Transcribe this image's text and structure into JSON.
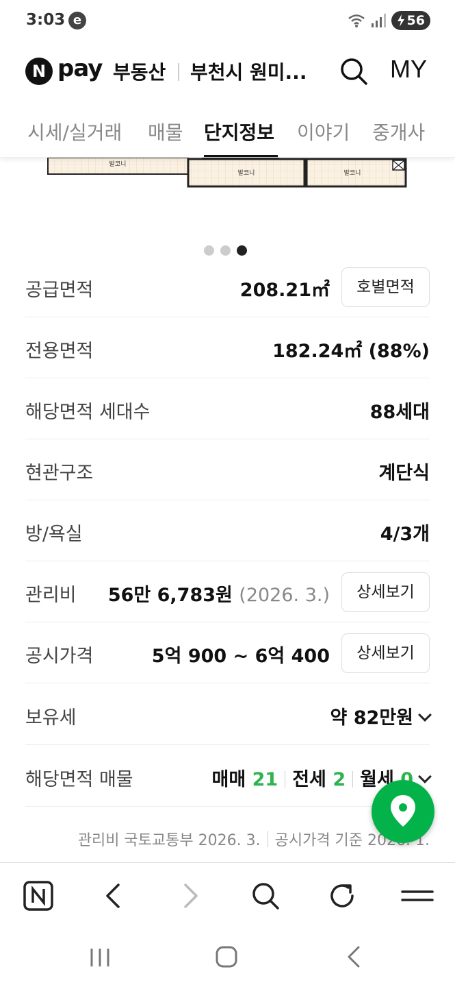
{
  "status_bar": {
    "time": "3:03",
    "carrier_icon": "e",
    "battery": "56"
  },
  "header": {
    "logo": "N",
    "pay": "pay",
    "service": "부동산",
    "region": "부천시 원미...",
    "my": "MY"
  },
  "tabs": [
    {
      "label": "시세/실거래",
      "active": false
    },
    {
      "label": "매물",
      "active": false
    },
    {
      "label": "단지정보",
      "active": true
    },
    {
      "label": "이야기",
      "active": false
    },
    {
      "label": "중개사",
      "active": false
    }
  ],
  "floorplan": {
    "room_labels": [
      "발코니",
      "발코니",
      "발코니"
    ]
  },
  "carousel": {
    "count": 3,
    "active_index": 2
  },
  "info": {
    "supply_area": {
      "label": "공급면적",
      "value": "208.21㎡",
      "button": "호별면적"
    },
    "exclusive_area": {
      "label": "전용면적",
      "value": "182.24㎡ (88%)"
    },
    "households": {
      "label": "해당면적 세대수",
      "value": "88세대"
    },
    "entrance": {
      "label": "현관구조",
      "value": "계단식"
    },
    "rooms": {
      "label": "방/욕실",
      "value": "4/3개"
    },
    "maintenance": {
      "label": "관리비",
      "value": "56만 6,783원",
      "date": "(2026. 3.)",
      "button": "상세보기"
    },
    "official_price": {
      "label": "공시가격",
      "value": "5억 900 ~ 6억 400",
      "button": "상세보기"
    },
    "tax": {
      "label": "보유세",
      "value": "약 82만원"
    },
    "listings": {
      "label": "해당면적 매물",
      "sale_label": "매매",
      "sale_count": "21",
      "jeonse_label": "전세",
      "jeonse_count": "2",
      "monthly_label": "월세",
      "monthly_count": "0"
    }
  },
  "footer_note": {
    "part1": "관리비 국토교통부 2026. 3.",
    "part2": "공시가격 기준 2026. 1."
  },
  "colors": {
    "accent_green": "#2eb34f",
    "fab_green": "#03b34a"
  },
  "browser_bar": [
    "naver-home-icon",
    "back-icon",
    "forward-icon",
    "search-icon",
    "refresh-icon",
    "menu-icon"
  ],
  "android_nav": [
    "recents-icon",
    "home-icon",
    "back-icon"
  ]
}
